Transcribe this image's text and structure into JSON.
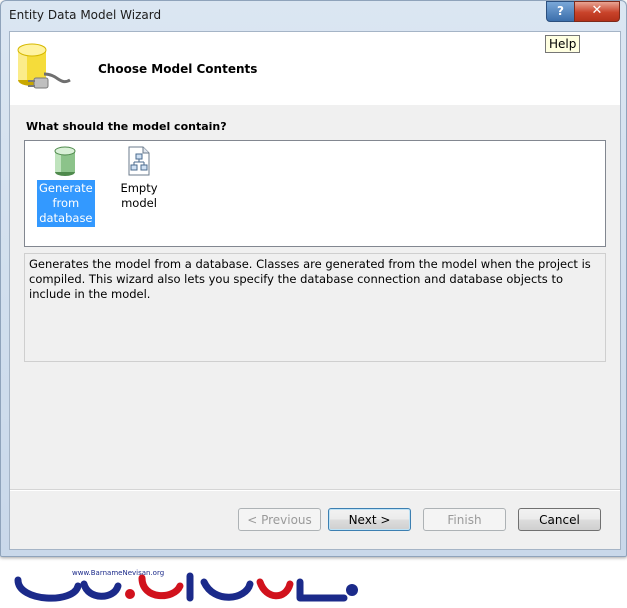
{
  "window": {
    "title": "Entity Data Model Wizard",
    "help_glyph": "?",
    "close_glyph": "✕"
  },
  "header": {
    "title": "Choose Model Contents",
    "help_tooltip": "Help"
  },
  "main": {
    "question": "What should the model contain?",
    "options": [
      {
        "label": "Generate from database",
        "selected": true,
        "icon": "database-icon"
      },
      {
        "label": "Empty model",
        "selected": false,
        "icon": "empty-model-icon"
      }
    ],
    "description": "Generates the model from a database. Classes are generated from the model when the project is compiled. This wizard also lets you specify the database connection and database objects to include in the model."
  },
  "buttons": {
    "previous": "< Previous",
    "next": "Next >",
    "finish": "Finish",
    "cancel": "Cancel"
  },
  "watermark": {
    "url": "www.BarnameNevisan.org",
    "logo_text": "برنامه نویسان"
  },
  "colors": {
    "selection": "#3399ff",
    "watermark_blue": "#1b2a8a",
    "watermark_red": "#d1121d"
  }
}
